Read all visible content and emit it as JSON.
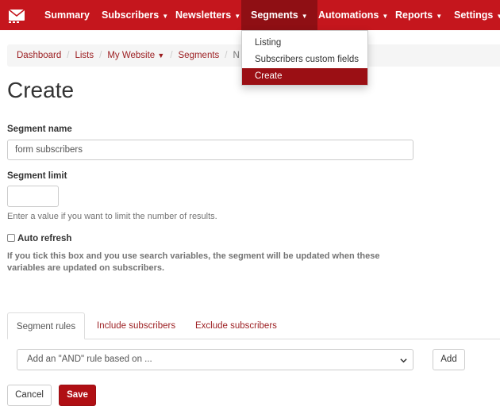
{
  "colors": {
    "brand": "#c5161d",
    "brand_dark": "#9b0f14",
    "link": "#9b1c1f"
  },
  "nav": {
    "logo_icon": "envelope-logo-icon",
    "items": [
      "Summary",
      "Subscribers",
      "Newsletters",
      "Segments",
      "Automations",
      "Reports",
      "Settings"
    ],
    "active": "Segments"
  },
  "dropdown": {
    "items": [
      "Listing",
      "Subscribers custom fields",
      "Create"
    ],
    "selected": "Create"
  },
  "breadcrumb": {
    "items": [
      "Dashboard",
      "Lists",
      "My Website",
      "Segments",
      "N"
    ]
  },
  "page": {
    "title": "Create"
  },
  "form": {
    "name_label": "Segment name",
    "name_value": "form subscribers",
    "limit_label": "Segment limit",
    "limit_value": "",
    "limit_help": "Enter a value if you want to limit the number of results.",
    "auto_refresh_label": "Auto refresh",
    "auto_refresh_checked": false,
    "auto_refresh_help": "If you tick this box and you use search variables, the segment will be updated when these variables are updated on subscribers."
  },
  "tabs": [
    "Segment rules",
    "Include subscribers",
    "Exclude subscribers"
  ],
  "rules": {
    "select_value": "Add an \"AND\" rule based on ...",
    "add_button": "Add"
  },
  "actions": {
    "cancel": "Cancel",
    "save": "Save"
  }
}
